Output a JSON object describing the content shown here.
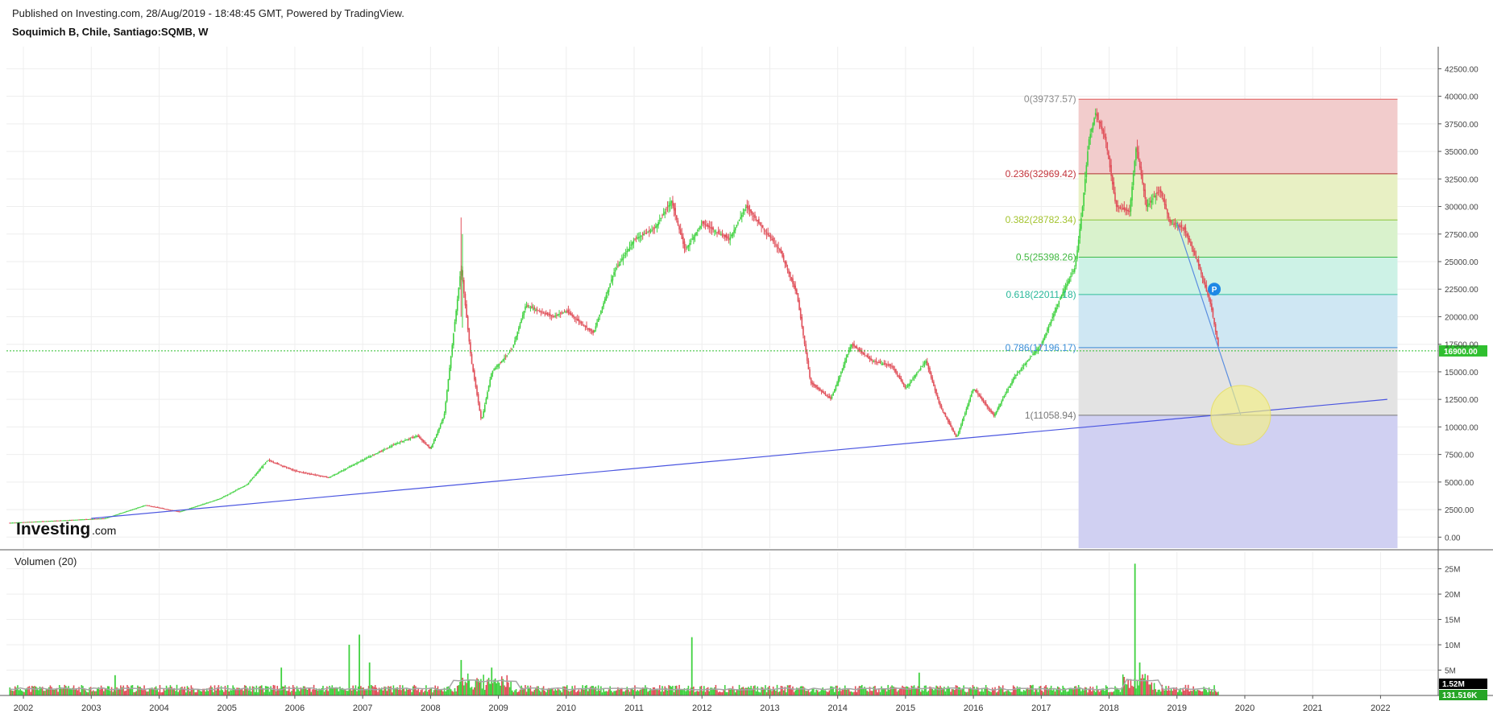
{
  "header": {
    "published": "Published on Investing.com, 28/Aug/2019 - 18:48:45 GMT, Powered by TradingView.",
    "symbol": "Soquimich B, Chile, Santiago:SQMB, W"
  },
  "watermark": {
    "brand": "Investing",
    "suffix": ".com"
  },
  "colors": {
    "up": "#3fd13f",
    "down": "#e0505a",
    "grid": "#eeeeee",
    "trendline": "#4a55e0",
    "last_price": "#2fbf2f",
    "volume_ma": "#a6a6a6"
  },
  "chart_data": [
    {
      "type": "candlestick",
      "title": "Soquimich B, Chile, Santiago:SQMB, W",
      "x_ticks": [
        "2002",
        "2003",
        "2004",
        "2005",
        "2006",
        "2007",
        "2008",
        "2009",
        "2010",
        "2011",
        "2012",
        "2013",
        "2014",
        "2015",
        "2016",
        "2017",
        "2018",
        "2019",
        "2020",
        "2021",
        "2022"
      ],
      "y_ticks": [
        "0.00",
        "2500.00",
        "5000.00",
        "7500.00",
        "10000.00",
        "12500.00",
        "15000.00",
        "17500.00",
        "20000.00",
        "22500.00",
        "25000.00",
        "27500.00",
        "30000.00",
        "32500.00",
        "35000.00",
        "37500.00",
        "40000.00",
        "42500.00"
      ],
      "ylim": [
        -1000,
        44500
      ],
      "xlim": [
        2001.75,
        2022.85
      ],
      "last_price": {
        "value": 16900,
        "label": "16900.00"
      },
      "price_path": [
        [
          2001.8,
          1300
        ],
        [
          2002.5,
          1500
        ],
        [
          2003.2,
          1700
        ],
        [
          2003.8,
          2900
        ],
        [
          2004.3,
          2300
        ],
        [
          2004.9,
          3500
        ],
        [
          2005.3,
          4800
        ],
        [
          2005.6,
          7000
        ],
        [
          2006.0,
          6000
        ],
        [
          2006.5,
          5400
        ],
        [
          2007.0,
          7000
        ],
        [
          2007.5,
          8500
        ],
        [
          2007.8,
          9200
        ],
        [
          2008.0,
          8000
        ],
        [
          2008.2,
          11000
        ],
        [
          2008.45,
          24500
        ],
        [
          2008.6,
          16000
        ],
        [
          2008.75,
          10500
        ],
        [
          2008.9,
          15000
        ],
        [
          2009.2,
          17000
        ],
        [
          2009.4,
          21000
        ],
        [
          2009.8,
          20000
        ],
        [
          2010.0,
          20500
        ],
        [
          2010.4,
          18500
        ],
        [
          2010.7,
          24000
        ],
        [
          2011.0,
          27000
        ],
        [
          2011.3,
          28000
        ],
        [
          2011.55,
          30500
        ],
        [
          2011.75,
          26000
        ],
        [
          2012.0,
          28500
        ],
        [
          2012.4,
          27000
        ],
        [
          2012.65,
          30000
        ],
        [
          2012.9,
          28000
        ],
        [
          2013.15,
          26000
        ],
        [
          2013.4,
          22000
        ],
        [
          2013.6,
          14000
        ],
        [
          2013.9,
          12500
        ],
        [
          2014.2,
          17500
        ],
        [
          2014.5,
          16000
        ],
        [
          2014.8,
          15500
        ],
        [
          2015.0,
          13500
        ],
        [
          2015.3,
          16000
        ],
        [
          2015.5,
          12000
        ],
        [
          2015.75,
          9000
        ],
        [
          2016.0,
          13500
        ],
        [
          2016.3,
          11000
        ],
        [
          2016.6,
          14500
        ],
        [
          2017.0,
          17500
        ],
        [
          2017.3,
          22000
        ],
        [
          2017.5,
          24500
        ],
        [
          2017.6,
          29500
        ],
        [
          2017.7,
          36000
        ],
        [
          2017.8,
          38500
        ],
        [
          2017.95,
          36000
        ],
        [
          2018.1,
          30000
        ],
        [
          2018.3,
          29500
        ],
        [
          2018.4,
          35500
        ],
        [
          2018.55,
          30000
        ],
        [
          2018.75,
          31500
        ],
        [
          2018.9,
          28500
        ],
        [
          2019.1,
          28000
        ],
        [
          2019.3,
          25000
        ],
        [
          2019.5,
          21000
        ],
        [
          2019.62,
          16900
        ]
      ],
      "trendline": {
        "from": [
          2003.0,
          1700
        ],
        "to": [
          2022.1,
          12500
        ]
      },
      "projection_line": {
        "from": [
          2019.0,
          28500
        ],
        "to": [
          2019.94,
          11058.94
        ]
      },
      "target_circle": {
        "center": [
          2019.94,
          11058.94
        ]
      },
      "marker_label": "P",
      "fibonacci": {
        "x_range": [
          2017.55,
          2022.25
        ],
        "levels": [
          {
            "label": "0(39737.57)",
            "value": 39737.57,
            "line": "#e05a5a",
            "fill": "#f2cccc",
            "text_color": "#8a8a8a"
          },
          {
            "label": "0.236(32969.42)",
            "value": 32969.42,
            "line": "#b03030",
            "fill": "#e8f0c4",
            "text_color": "#c2333b"
          },
          {
            "label": "0.382(28782.34)",
            "value": 28782.34,
            "line": "#8ac43a",
            "fill": "#d9f2cc",
            "text_color": "#a4c430"
          },
          {
            "label": "0.5(25398.26)",
            "value": 25398.26,
            "line": "#3dba4a",
            "fill": "#cdf2e6",
            "text_color": "#3fb83f"
          },
          {
            "label": "0.618(22011.18)",
            "value": 22011.18,
            "line": "#2fbf9a",
            "fill": "#cfe7f3",
            "text_color": "#28b89a"
          },
          {
            "label": "0.786(17196.17)",
            "value": 17196.17,
            "line": "#3a8ad8",
            "fill": "#e3e3e3",
            "text_color": "#3b8fd8"
          },
          {
            "label": "1(11058.94)",
            "value": 11058.94,
            "line": "#777777",
            "fill": "#d0d0f2",
            "text_color": "#777777"
          }
        ],
        "bottom_fill": "#d0d0f2"
      }
    },
    {
      "type": "bar",
      "title": "Volumen (20)",
      "y_ticks": [
        "5M",
        "10M",
        "15M",
        "20M",
        "25M"
      ],
      "ylim": [
        0,
        27000000
      ],
      "last_values": [
        {
          "label": "1.52M",
          "bg": "#000000"
        },
        {
          "label": "131.516K",
          "bg": "#26a526"
        }
      ],
      "spikes": [
        [
          2003.35,
          4000000
        ],
        [
          2005.8,
          5500000
        ],
        [
          2006.8,
          10000000
        ],
        [
          2006.95,
          12000000
        ],
        [
          2007.1,
          6500000
        ],
        [
          2008.45,
          7000000
        ],
        [
          2008.9,
          5500000
        ],
        [
          2011.85,
          11500000
        ],
        [
          2015.2,
          4500000
        ],
        [
          2018.38,
          26000000
        ],
        [
          2018.45,
          6500000
        ]
      ]
    }
  ]
}
